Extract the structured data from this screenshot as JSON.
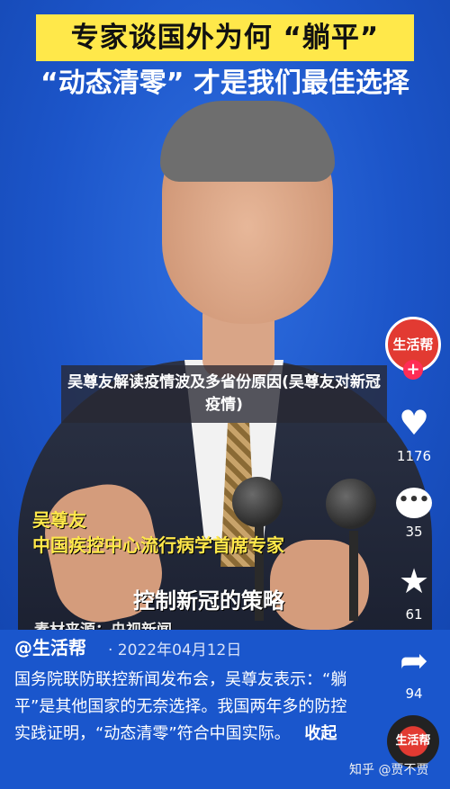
{
  "video": {
    "headline_line1": "专家谈国外为何 “躺平”",
    "headline_line2": "“动态清零” 才是我们最佳选择",
    "overlay_title": "吴尊友解读疫情波及多省份原因(吴尊友对新冠疫情)",
    "name_caption": "吴尊友",
    "role_caption": "中国疾控中心流行病学首席专家",
    "topic_caption": "控制新冠的策略",
    "source_caption": "素材来源：央视新闻"
  },
  "post": {
    "author": "@生活帮",
    "date": "· 2022年04月12日",
    "description": "国务院联防联控新闻发布会，吴尊友表示：“躺平”是其他国家的无奈选择。我国两年多的防控实践证明，“动态清零”符合中国实际。",
    "collapse_label": "收起"
  },
  "sidebar": {
    "avatar_label": "生活帮",
    "follow_symbol": "+",
    "like_icon": "♥",
    "like_count": "1176",
    "comment_icon": "•••",
    "comment_count": "35",
    "favorite_icon": "★",
    "favorite_count": "61",
    "share_icon": "➦",
    "share_count": "94",
    "disc_label": "生活帮"
  },
  "watermark": "知乎 @贾不贾",
  "colors": {
    "background_blue": "#1652c8",
    "headline_yellow": "#ffe84a",
    "caption_yellow": "#ffe84a",
    "accent_red": "#e23a32"
  }
}
